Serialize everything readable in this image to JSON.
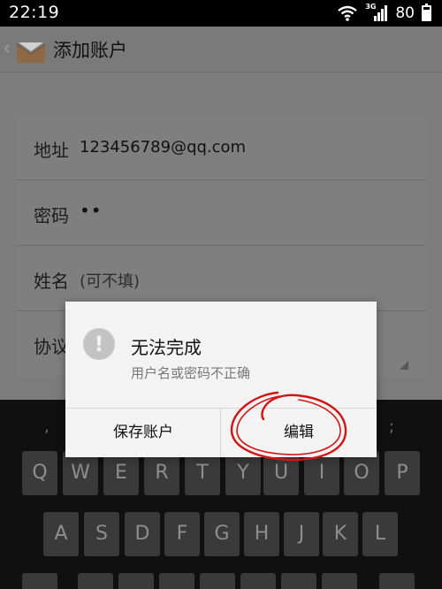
{
  "status_bar": {
    "time": "22:19",
    "network_type": "3G",
    "battery": "80",
    "battery_level": 0.8
  },
  "action_bar": {
    "title": "添加账户",
    "icon": "mail-icon"
  },
  "form": {
    "address": {
      "label": "地址",
      "value": "123456789@qq.com"
    },
    "password": {
      "label": "密码",
      "value": "••"
    },
    "name": {
      "label": "姓名",
      "placeholder": "(可不填)"
    },
    "protocol": {
      "label": "协议"
    }
  },
  "dialog": {
    "icon": "alert-icon",
    "title": "无法完成",
    "message": "用户名或密码不正确",
    "save_account_label": "保存账户",
    "edit_label": "编辑"
  },
  "annotation": {
    "color": "#d21414",
    "shape": "hand-drawn circle"
  },
  "keyboard": {
    "symbols": [
      ",",
      ";"
    ],
    "row1": [
      "Q",
      "W",
      "E",
      "R",
      "T",
      "Y",
      "U",
      "I",
      "O",
      "P"
    ],
    "row2": [
      "A",
      "S",
      "D",
      "F",
      "G",
      "H",
      "J",
      "K",
      "L"
    ]
  }
}
